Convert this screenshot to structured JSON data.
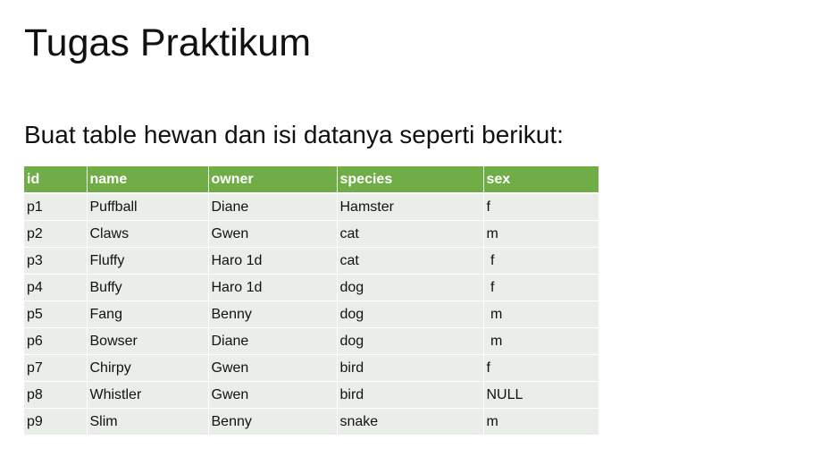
{
  "slide": {
    "title": "Tugas Praktikum",
    "subtitle": "Buat table hewan dan isi datanya seperti berikut:"
  },
  "colors": {
    "header_background": "#70ad47",
    "row_background": "#eaeee8",
    "header_text": "#ffffff"
  },
  "table": {
    "columns": [
      "id",
      "name",
      "owner",
      "species",
      "sex"
    ],
    "rows": [
      [
        "p1",
        "Puffball",
        "Diane",
        "Hamster",
        "f"
      ],
      [
        "p2",
        "Claws",
        "Gwen",
        "cat",
        "m"
      ],
      [
        "p3",
        "Fluffy",
        "Haro 1d",
        "cat",
        " f"
      ],
      [
        "p4",
        "Buffy",
        "Haro 1d",
        "dog",
        " f"
      ],
      [
        "p5",
        "Fang",
        "Benny",
        "dog",
        " m"
      ],
      [
        "p6",
        "Bowser",
        "Diane",
        "dog",
        " m"
      ],
      [
        "p7",
        "Chirpy",
        "Gwen",
        "bird",
        "f"
      ],
      [
        "p8",
        "Whistler",
        "Gwen",
        "bird",
        "NULL"
      ],
      [
        "p9",
        "Slim",
        "Benny",
        "snake",
        "m"
      ]
    ]
  }
}
